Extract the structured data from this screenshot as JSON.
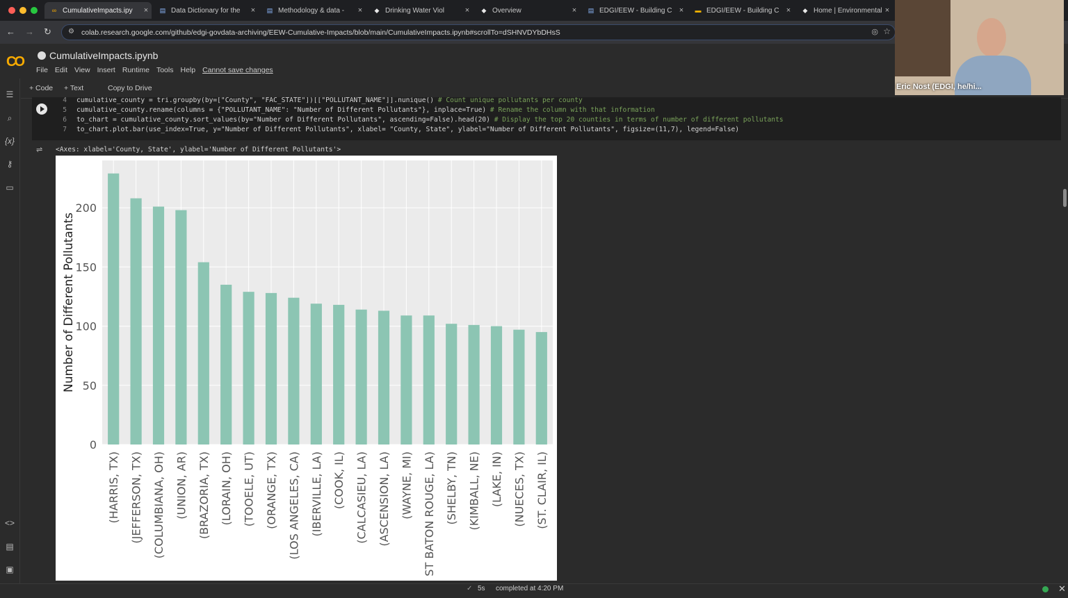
{
  "browser": {
    "tabs": [
      {
        "label": "CumulativeImpacts.ipy",
        "icon": "colab-icon",
        "active": true
      },
      {
        "label": "Data Dictionary for the",
        "icon": "doc-icon"
      },
      {
        "label": "Methodology & data -",
        "icon": "doc-icon"
      },
      {
        "label": "Drinking Water Viol",
        "icon": "page-icon"
      },
      {
        "label": "Overview",
        "icon": "page-icon"
      },
      {
        "label": "EDGI/EEW - Building C",
        "icon": "doc-icon"
      },
      {
        "label": "EDGI/EEW - Building C",
        "icon": "slides-icon"
      },
      {
        "label": "Home | Environmental",
        "icon": "page-icon"
      }
    ],
    "close_glyph": "×",
    "url": "colab.research.google.com/github/edgi-govdata-archiving/EEW-Cumulative-Impacts/blob/main/CumulativeImpacts.ipynb#scrollTo=dSHNVDYbDHsS"
  },
  "colab": {
    "logo": "CO",
    "notebook_title": "CumulativeImpacts.ipynb",
    "menu": [
      "File",
      "Edit",
      "View",
      "Insert",
      "Runtime",
      "Tools",
      "Help"
    ],
    "cannot_save": "Cannot save changes",
    "toolbar": {
      "code": "+ Code",
      "text": "+ Text",
      "copy": "Copy to Drive"
    }
  },
  "code_cell": {
    "lines": [
      {
        "n": "4",
        "code": "cumulative_county = tri.groupby(by=[\"County\", \"FAC_STATE\"])[[\"POLLUTANT_NAME\"]].nunique() ",
        "comment": "# Count unique pollutants per county"
      },
      {
        "n": "5",
        "code": "cumulative_county.rename(columns = {\"POLLUTANT_NAME\": \"Number of Different Pollutants\"}, inplace=True) ",
        "comment": "# Rename the column with that information"
      },
      {
        "n": "6",
        "code": "to_chart = cumulative_county.sort_values(by=\"Number of Different Pollutants\", ascending=False).head(20) ",
        "comment": "# Display the top 20 counties in terms of number of different pollutants"
      },
      {
        "n": "7",
        "code": "to_chart.plot.bar(use_index=True, y=\"Number of Different Pollutants\", xlabel= \"County, State\", ylabel=\"Number of Different Pollutants\", figsize=(11,7), legend=False)",
        "comment": ""
      }
    ],
    "output_repr": "<Axes: xlabel='County, State', ylabel='Number of Different Pollutants'>"
  },
  "chart_data": {
    "type": "bar",
    "categories": [
      "(HARRIS, TX)",
      "(JEFFERSON, TX)",
      "(COLUMBIANA, OH)",
      "(UNION, AR)",
      "(BRAZORIA, TX)",
      "(LORAIN, OH)",
      "(TOOELE, UT)",
      "(ORANGE, TX)",
      "(LOS ANGELES, CA)",
      "(IBERVILLE, LA)",
      "(COOK, IL)",
      "(CALCASIEU, LA)",
      "(ASCENSION, LA)",
      "(WAYNE, MI)",
      "ST BATON ROUGE, LA)",
      "(SHELBY, TN)",
      "(KIMBALL, NE)",
      "(LAKE, IN)",
      "(NUECES, TX)",
      "(ST. CLAIR, IL)"
    ],
    "values": [
      229,
      208,
      201,
      198,
      154,
      135,
      129,
      128,
      124,
      119,
      118,
      114,
      113,
      109,
      109,
      102,
      101,
      100,
      97,
      95
    ],
    "ylabel": "Number of Different Pollutants",
    "xlabel": "",
    "yticks": [
      0,
      50,
      100,
      150,
      200
    ],
    "ylim": [
      0,
      240
    ],
    "bar_color": "#8cc5b3",
    "background": "#ebebeb",
    "grid": true
  },
  "status": {
    "check": "✓",
    "duration": "5s",
    "message": "completed at 4:20 PM"
  },
  "video": {
    "name": "Eric Nost (EDGI, he/hi..."
  }
}
